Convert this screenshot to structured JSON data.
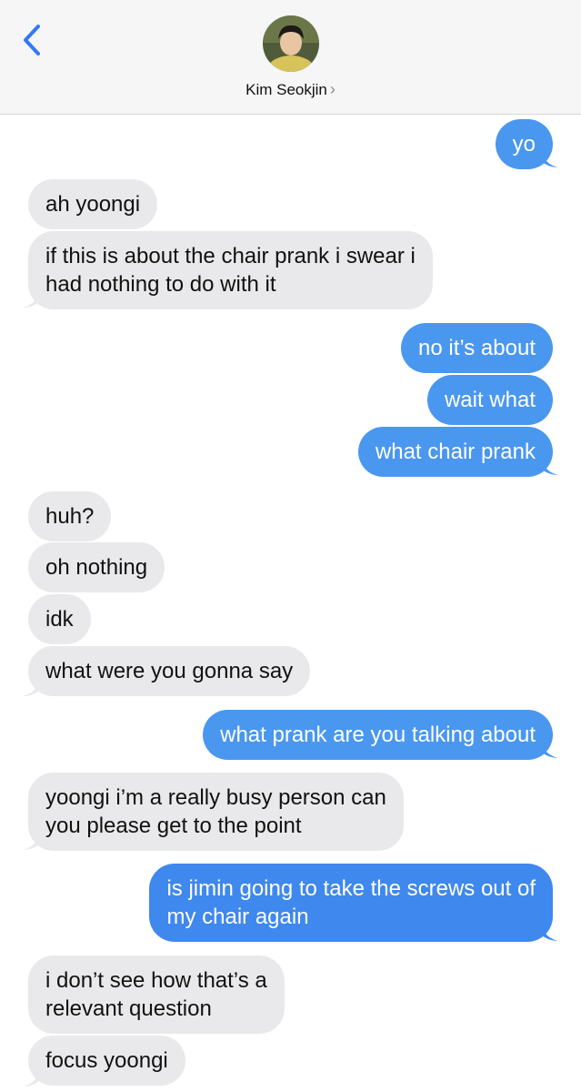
{
  "header": {
    "contact_name": "Kim Seokjin",
    "chevron": "›",
    "back_icon": "chevron-left-icon",
    "colors": {
      "accent": "#3478f6",
      "header_bg": "#f6f6f6"
    }
  },
  "colors": {
    "incoming": "#e9e9eb",
    "outgoing": "#4a97ef"
  },
  "messages": [
    {
      "side": "out",
      "text": "yo"
    },
    {
      "side": "in",
      "text": "ah yoongi"
    },
    {
      "side": "in",
      "lines": [
        "if this is about the chair prank i swear i",
        "had nothing to do with it"
      ]
    },
    {
      "side": "out",
      "text": "no it’s about"
    },
    {
      "side": "out",
      "text": "wait what"
    },
    {
      "side": "out",
      "text": "what chair prank"
    },
    {
      "side": "in",
      "text": "huh?"
    },
    {
      "side": "in",
      "text": "oh nothing"
    },
    {
      "side": "in",
      "text": "idk"
    },
    {
      "side": "in",
      "text": "what were you gonna say"
    },
    {
      "side": "out",
      "text": "what prank are you talking about"
    },
    {
      "side": "in",
      "lines": [
        "yoongi i’m a really busy person can",
        "you please get to the point"
      ]
    },
    {
      "side": "out",
      "lines": [
        "is jimin going to take the screws out of",
        "my chair again"
      ]
    },
    {
      "side": "in",
      "lines": [
        "i don’t see how that’s a",
        "relevant question"
      ]
    },
    {
      "side": "in",
      "text": "focus yoongi"
    }
  ]
}
